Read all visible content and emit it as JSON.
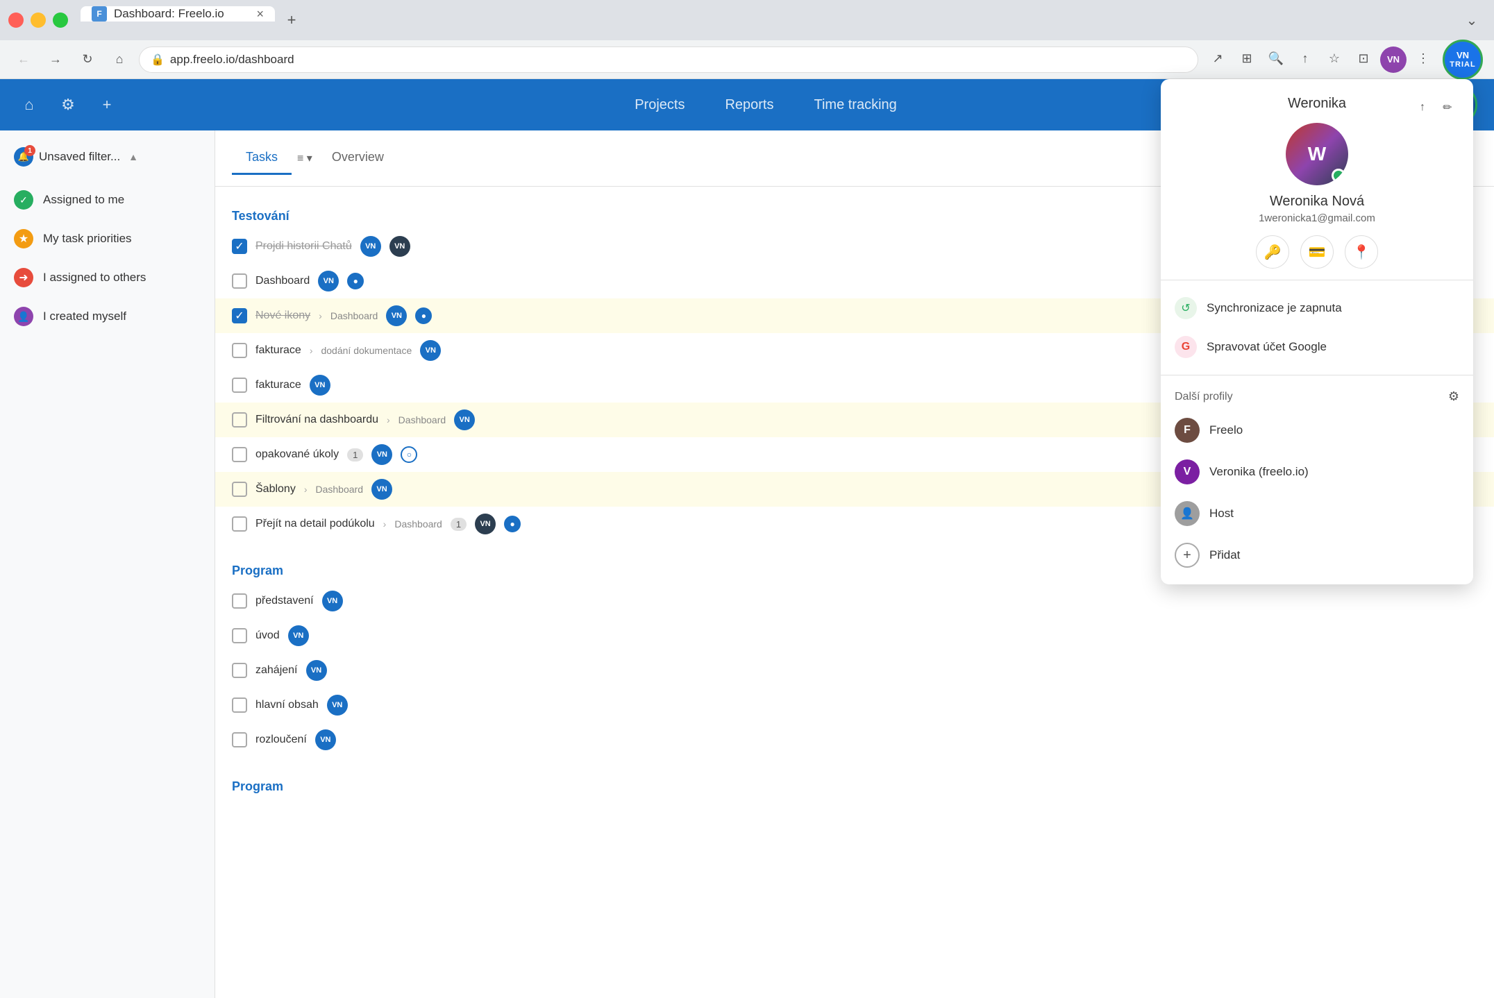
{
  "browser": {
    "tab_favicon": "F",
    "tab_title": "Dashboard: Freelo.io",
    "tab_close": "×",
    "new_tab": "+",
    "url": "app.freelo.io/dashboard",
    "nav_back": "←",
    "nav_forward": "→",
    "nav_reload": "↻",
    "nav_home": "⌂",
    "more_btn": "⋮",
    "profile_initials": "VN",
    "trial_label": "TRIAL"
  },
  "app_nav": {
    "home_icon": "⌂",
    "settings_icon": "⚙",
    "add_icon": "+",
    "projects": "Projects",
    "reports": "Reports",
    "time_tracking": "Time tracking",
    "play_icon": "▷",
    "trial_label": "TRIAL",
    "trial_initials": "VN"
  },
  "sidebar": {
    "filter_label": "Unsaved filter...",
    "filter_icon": "▲",
    "notification_count": "1",
    "items": [
      {
        "label": "Assigned to me",
        "color": "green"
      },
      {
        "label": "My task priorities",
        "color": "yellow"
      },
      {
        "label": "I assigned to others",
        "color": "red"
      },
      {
        "label": "I created myself",
        "color": "purple"
      }
    ]
  },
  "content": {
    "tasks_tab": "Tasks",
    "overview_tab": "Overview",
    "filter_icon": "≡",
    "header_icon1": "↗",
    "header_icon2": "↑",
    "groups": [
      {
        "name": "Testování",
        "tasks": [
          {
            "id": 1,
            "name": "Projdi historii Chatů",
            "checked": true,
            "strikethrough": true,
            "breadcrumb": "",
            "avatar": "VN",
            "avatar_dark": false,
            "badge": "",
            "has_circle": false,
            "highlighted": false
          },
          {
            "id": 2,
            "name": "Dashboard",
            "checked": false,
            "strikethrough": false,
            "breadcrumb": "",
            "avatar": "VN",
            "avatar_dark": false,
            "badge": "",
            "has_circle": true,
            "circle_filled": true,
            "highlighted": false
          },
          {
            "id": 3,
            "name": "Nové ikony",
            "checked": true,
            "strikethrough": true,
            "breadcrumb": "Dashboard",
            "avatar": "VN",
            "avatar_dark": false,
            "badge": "",
            "has_circle": true,
            "circle_filled": true,
            "highlighted": true
          },
          {
            "id": 4,
            "name": "fakturace",
            "checked": false,
            "strikethrough": false,
            "breadcrumb": "dodání dokumentace",
            "avatar": "VN",
            "avatar_dark": false,
            "badge": "",
            "has_circle": false,
            "highlighted": false
          },
          {
            "id": 5,
            "name": "fakturace",
            "checked": false,
            "strikethrough": false,
            "breadcrumb": "",
            "avatar": "VN",
            "avatar_dark": false,
            "badge": "",
            "has_circle": false,
            "highlighted": false
          },
          {
            "id": 6,
            "name": "Filtrování na dashboardu",
            "checked": false,
            "strikethrough": false,
            "breadcrumb": "Dashboard",
            "avatar": "VN",
            "avatar_dark": false,
            "badge": "",
            "has_circle": false,
            "highlighted": true
          },
          {
            "id": 7,
            "name": "opakované úkoly",
            "checked": false,
            "strikethrough": false,
            "breadcrumb": "",
            "avatar": "VN",
            "avatar_dark": false,
            "badge": "1",
            "has_circle": true,
            "circle_filled": false,
            "highlighted": false
          },
          {
            "id": 8,
            "name": "Šablony",
            "checked": false,
            "strikethrough": false,
            "breadcrumb": "Dashboard",
            "avatar": "VN",
            "avatar_dark": false,
            "badge": "",
            "has_circle": false,
            "highlighted": true
          },
          {
            "id": 9,
            "name": "Přejít na detail podúkolu",
            "checked": false,
            "strikethrough": false,
            "breadcrumb": "Dashboard",
            "avatar": "VN",
            "avatar_dark": true,
            "badge": "1",
            "has_circle": true,
            "circle_filled": true,
            "highlighted": false
          }
        ]
      },
      {
        "name": "Program",
        "tasks": [
          {
            "id": 10,
            "name": "představení",
            "checked": false,
            "strikethrough": false,
            "breadcrumb": "",
            "avatar": "VN",
            "avatar_dark": false,
            "badge": "",
            "has_circle": false,
            "highlighted": false
          },
          {
            "id": 11,
            "name": "úvod",
            "checked": false,
            "strikethrough": false,
            "breadcrumb": "",
            "avatar": "VN",
            "avatar_dark": false,
            "badge": "",
            "has_circle": false,
            "highlighted": false
          },
          {
            "id": 12,
            "name": "zahájení",
            "checked": false,
            "strikethrough": false,
            "breadcrumb": "",
            "avatar": "VN",
            "avatar_dark": false,
            "badge": "",
            "has_circle": false,
            "highlighted": false
          },
          {
            "id": 13,
            "name": "hlavní obsah",
            "checked": false,
            "strikethrough": false,
            "breadcrumb": "",
            "avatar": "VN",
            "avatar_dark": false,
            "badge": "",
            "has_circle": false,
            "highlighted": false
          },
          {
            "id": 14,
            "name": "rozloučení",
            "checked": false,
            "strikethrough": false,
            "breadcrumb": "",
            "avatar": "VN",
            "avatar_dark": false,
            "badge": "",
            "has_circle": false,
            "highlighted": false
          }
        ]
      },
      {
        "name": "Program",
        "tasks": []
      }
    ]
  },
  "profile_dropdown": {
    "title": "Weronika",
    "name": "Weronika Nová",
    "email": "1weronicka1@gmail.com",
    "edit_icon": "✏",
    "share_icon": "↑",
    "key_icon": "🔑",
    "card_icon": "💳",
    "location_icon": "📍",
    "sync_label": "Synchronizace je zapnuta",
    "google_label": "Spravovat účet Google",
    "google_letter": "G",
    "profiles_header": "Další profily",
    "gear_icon": "⚙",
    "profiles": [
      {
        "initial": "F",
        "label": "Freelo",
        "color": "brown"
      },
      {
        "initial": "V",
        "label": "Veronika (freelo.io)",
        "color": "purple"
      },
      {
        "initial": "👤",
        "label": "Host",
        "color": "gray"
      }
    ],
    "add_label": "Přidat",
    "add_icon": "+"
  }
}
